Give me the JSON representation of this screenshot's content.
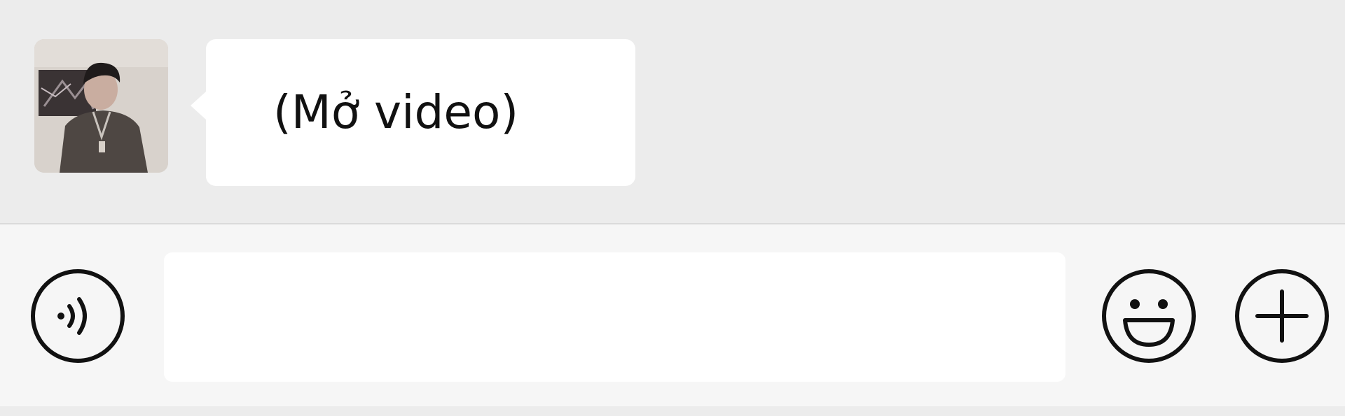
{
  "chat": {
    "messages": [
      {
        "sender_avatar": "avatar-photo",
        "text": "(Mở video)",
        "direction": "incoming"
      }
    ]
  },
  "input_bar": {
    "text_value": "",
    "placeholder": "",
    "icons": {
      "left": "voice-icon",
      "right_1": "emoji-icon",
      "right_2": "plus-icon"
    }
  },
  "colors": {
    "chat_background": "#ececec",
    "bubble_background": "#ffffff",
    "input_bar_background": "#f6f6f6",
    "text": "#111111",
    "icon_stroke": "#111111"
  }
}
